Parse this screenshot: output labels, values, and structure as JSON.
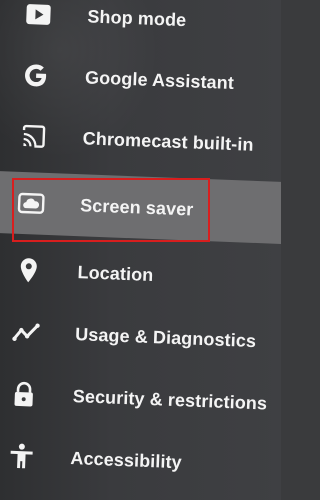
{
  "menu": {
    "items": [
      {
        "label": "Shop mode",
        "icon": "play-icon"
      },
      {
        "label": "Google Assistant",
        "icon": "google-g-icon"
      },
      {
        "label": "Chromecast built-in",
        "icon": "cast-icon"
      },
      {
        "label": "Screen saver",
        "icon": "screensaver-icon",
        "selected": true
      },
      {
        "label": "Location",
        "icon": "location-pin-icon"
      },
      {
        "label": "Usage & Diagnostics",
        "icon": "trend-line-icon"
      },
      {
        "label": "Security & restrictions",
        "icon": "lock-icon"
      },
      {
        "label": "Accessibility",
        "icon": "accessibility-icon"
      }
    ]
  },
  "colors": {
    "highlight_border": "#d81e1e",
    "selected_bg": "#6e6e70",
    "text": "#f4f4f4"
  }
}
